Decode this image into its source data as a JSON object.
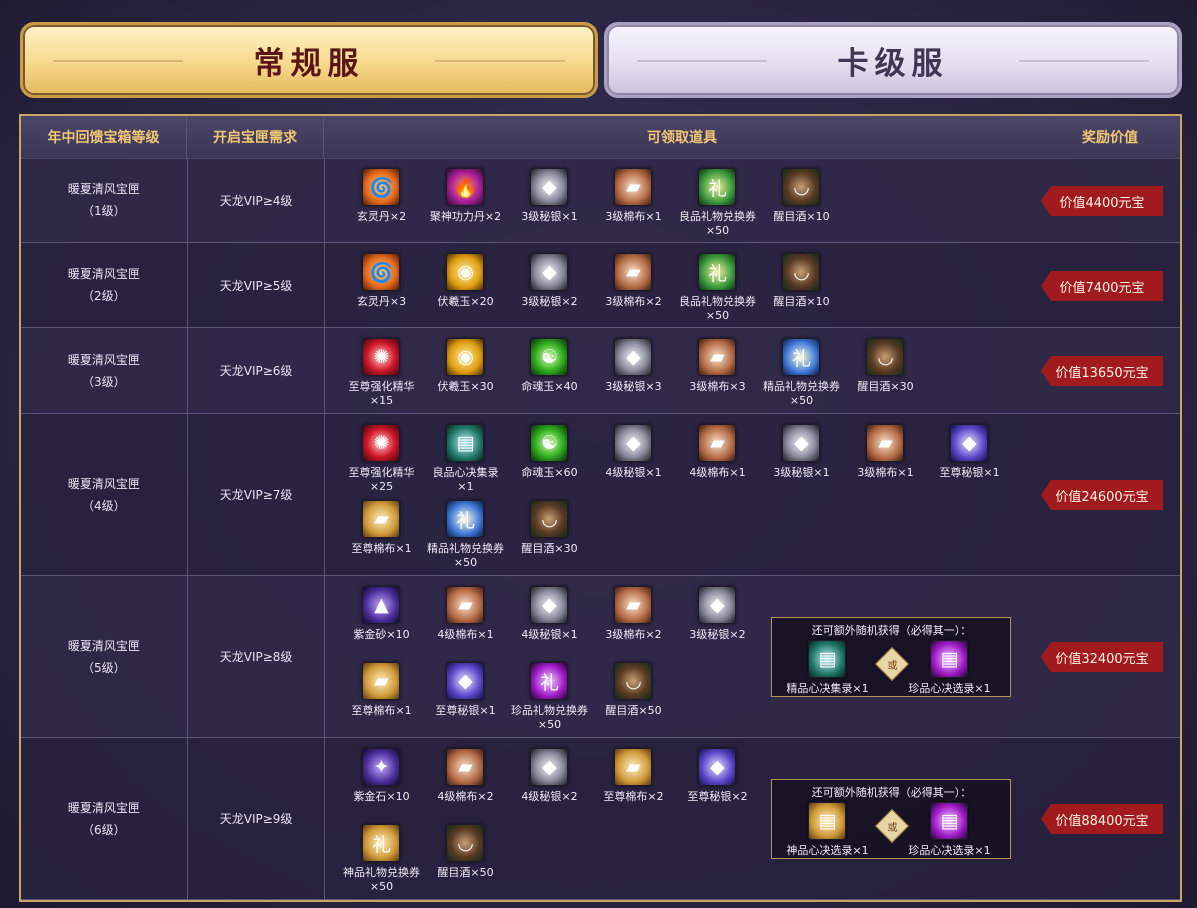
{
  "tabs": {
    "normal": "常规服",
    "card": "卡级服"
  },
  "headers": {
    "level": "年中回馈宝箱等级",
    "requirement": "开启宝匣需求",
    "items": "可领取道具",
    "value": "奖励价值"
  },
  "rows": [
    {
      "name": "暖夏清风宝匣",
      "level": "（1级）",
      "req": "天龙VIP≥4级",
      "value": "价值4400元宝",
      "items": [
        {
          "label": "玄灵丹×2",
          "icon": "spiral-pill-icon"
        },
        {
          "label": "聚神功力丹×2",
          "icon": "fire-pill-icon"
        },
        {
          "label": "3级秘银×1",
          "icon": "silver-ore-icon"
        },
        {
          "label": "3级棉布×1",
          "icon": "cloth-icon"
        },
        {
          "label": "良品礼物兑换券",
          "label2": "×50",
          "icon": "gift-voucher-icon"
        },
        {
          "label": "醒目酒×10",
          "icon": "wine-bowl-icon"
        }
      ]
    },
    {
      "name": "暖夏清风宝匣",
      "level": "（2级）",
      "req": "天龙VIP≥5级",
      "value": "价值7400元宝",
      "items": [
        {
          "label": "玄灵丹×3",
          "icon": "spiral-pill-icon"
        },
        {
          "label": "伏羲玉×20",
          "icon": "gold-jade-icon"
        },
        {
          "label": "3级秘银×2",
          "icon": "silver-ore-icon"
        },
        {
          "label": "3级棉布×2",
          "icon": "cloth-icon"
        },
        {
          "label": "良品礼物兑换券",
          "label2": "×50",
          "icon": "gift-voucher-icon"
        },
        {
          "label": "醒目酒×10",
          "icon": "wine-bowl-icon"
        }
      ]
    },
    {
      "name": "暖夏清风宝匣",
      "level": "（3级）",
      "req": "天龙VIP≥6级",
      "value": "价值13650元宝",
      "items": [
        {
          "label": "至尊强化精华",
          "label2": "×15",
          "icon": "red-essence-icon"
        },
        {
          "label": "伏羲玉×30",
          "icon": "gold-jade-icon"
        },
        {
          "label": "命魂玉×40",
          "icon": "green-soul-jade-icon"
        },
        {
          "label": "3级秘银×3",
          "icon": "silver-ore-icon"
        },
        {
          "label": "3级棉布×3",
          "icon": "cloth-icon"
        },
        {
          "label": "精品礼物兑换券",
          "label2": "×50",
          "icon": "blue-voucher-icon"
        },
        {
          "label": "醒目酒×30",
          "icon": "wine-bowl-icon"
        }
      ]
    },
    {
      "name": "暖夏清风宝匣",
      "level": "（4级）",
      "req": "天龙VIP≥7级",
      "value": "价值24600元宝",
      "items": [
        {
          "label": "至尊强化精华",
          "label2": "×25",
          "icon": "red-essence-icon"
        },
        {
          "label": "良品心决集录",
          "label2": "×1",
          "icon": "book-icon"
        },
        {
          "label": "命魂玉×60",
          "icon": "green-soul-jade-icon"
        },
        {
          "label": "4级秘银×1",
          "icon": "silver-ore-icon"
        },
        {
          "label": "4级棉布×1",
          "icon": "cloth-icon"
        },
        {
          "label": "3级秘银×1",
          "icon": "silver-ore-icon"
        },
        {
          "label": "3级棉布×1",
          "icon": "cloth-icon"
        },
        {
          "label": "至尊秘银×1",
          "icon": "violet-silver-icon"
        },
        {
          "label": "至尊棉布×1",
          "icon": "gold-cloth-icon"
        },
        {
          "label": "精品礼物兑换券",
          "label2": "×50",
          "icon": "blue-voucher-icon"
        },
        {
          "label": "醒目酒×30",
          "icon": "wine-bowl-icon"
        }
      ]
    },
    {
      "name": "暖夏清风宝匣",
      "level": "（5级）",
      "req": "天龙VIP≥8级",
      "value": "价值32400元宝",
      "items": [
        {
          "label": "紫金砂×10",
          "icon": "purple-sand-icon"
        },
        {
          "label": "4级棉布×1",
          "icon": "cloth-icon"
        },
        {
          "label": "4级秘银×1",
          "icon": "silver-ore-icon"
        },
        {
          "label": "3级棉布×2",
          "icon": "cloth-icon"
        },
        {
          "label": "3级秘银×2",
          "icon": "silver-ore-icon"
        },
        {
          "label": "至尊棉布×1",
          "icon": "gold-cloth-icon"
        },
        {
          "label": "至尊秘银×1",
          "icon": "violet-silver-icon"
        },
        {
          "label": "珍品礼物兑换券",
          "label2": "×50",
          "icon": "purple-voucher-icon"
        },
        {
          "label": "醒目酒×50",
          "icon": "wine-bowl-icon"
        }
      ],
      "extra": {
        "title": "还可额外随机获得（必得其一）：",
        "or": "或",
        "a": "精品心决集录×1",
        "b": "珍品心决选录×1"
      }
    },
    {
      "name": "暖夏清风宝匣",
      "level": "（6级）",
      "req": "天龙VIP≥9级",
      "value": "价值88400元宝",
      "items": [
        {
          "label": "紫金石×10",
          "icon": "purple-crystal-icon"
        },
        {
          "label": "4级棉布×2",
          "icon": "cloth-icon"
        },
        {
          "label": "4级秘银×2",
          "icon": "silver-ore-icon"
        },
        {
          "label": "至尊棉布×2",
          "icon": "gold-cloth-icon"
        },
        {
          "label": "至尊秘银×2",
          "icon": "violet-silver-icon"
        },
        {
          "label": "神品礼物兑换券",
          "label2": "×50",
          "icon": "gold-voucher-icon"
        },
        {
          "label": "醒目酒×50",
          "icon": "wine-bowl-icon"
        }
      ],
      "extra": {
        "title": "还可额外随机获得（必得其一）：",
        "or": "或",
        "a": "神品心决选录×1",
        "b": "珍品心决选录×1"
      }
    }
  ]
}
